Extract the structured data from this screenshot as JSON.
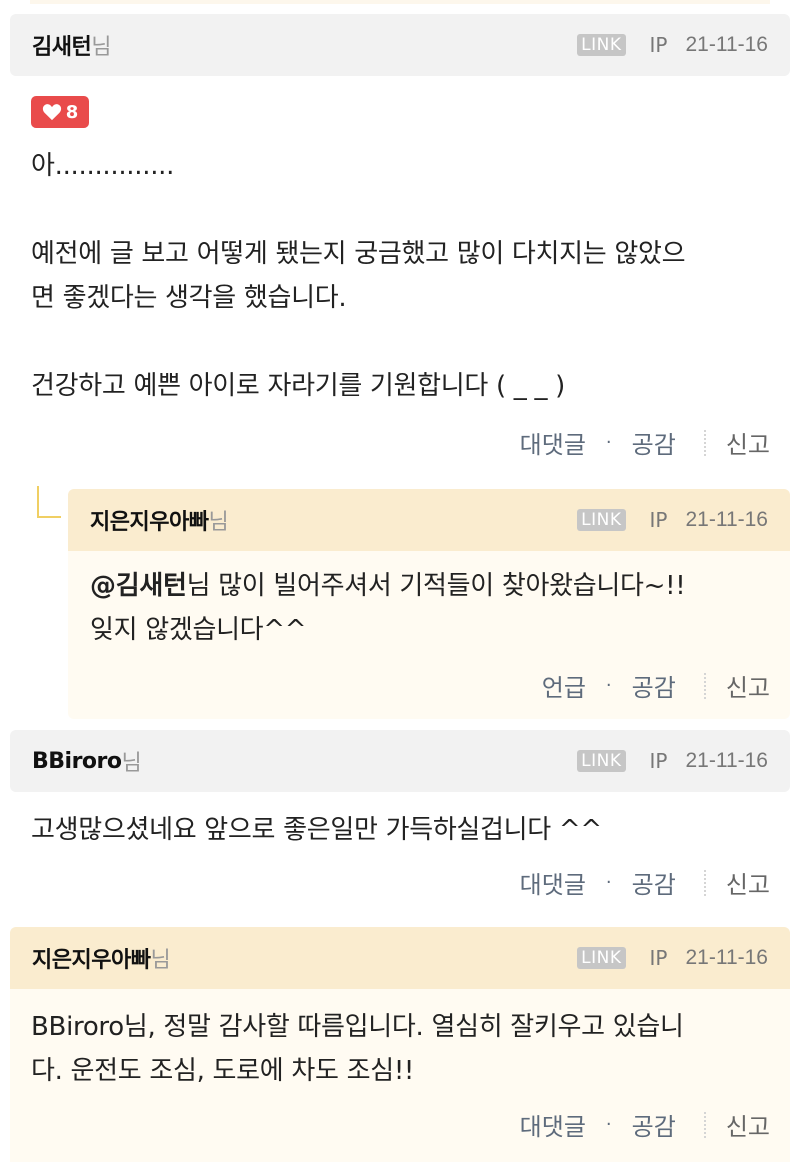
{
  "comments": [
    {
      "author": "김새턴",
      "suffix": "님",
      "link_label": "LINK",
      "ip_label": "IP",
      "date": "21-11-16",
      "likes": "8",
      "body": "아...............\n\n예전에 글 보고 어떻게 됐는지 궁금했고 많이 다치지는 않았으\n면 좋겠다는 생각을 했습니다.\n\n건강하고 예쁜 아이로 자라기를 기원합니다 ( _ _ )",
      "actions": {
        "reply": "대댓글",
        "like": "공감",
        "report": "신고"
      }
    },
    {
      "author": "지은지우아빠",
      "suffix": "님",
      "link_label": "LINK",
      "ip_label": "IP",
      "date": "21-11-16",
      "mention": "@김새턴",
      "body_after_mention": "님 많이 빌어주셔서 기적들이 찾아왔습니다~!!\n잊지 않겠습니다^^",
      "actions": {
        "reply": "언급",
        "like": "공감",
        "report": "신고"
      }
    },
    {
      "author": "BBiroro",
      "suffix": "님",
      "link_label": "LINK",
      "ip_label": "IP",
      "date": "21-11-16",
      "body": "고생많으셨네요 앞으로 좋은일만 가득하실겁니다 ^^",
      "actions": {
        "reply": "대댓글",
        "like": "공감",
        "report": "신고"
      }
    },
    {
      "author": "지은지우아빠",
      "suffix": "님",
      "link_label": "LINK",
      "ip_label": "IP",
      "date": "21-11-16",
      "body": "BBiroro님, 정말 감사할 따름입니다. 열심히 잘키우고 있습니\n다. 운전도 조심, 도로에 차도 조심!!",
      "actions": {
        "reply": "대댓글",
        "like": "공감",
        "report": "신고"
      }
    }
  ],
  "colors": {
    "header_gray": "#f2f2f2",
    "header_author": "#faeccf",
    "author_body": "#fffbf2",
    "like_badge": "#e94b4b",
    "action_text": "#5e6b7c"
  }
}
